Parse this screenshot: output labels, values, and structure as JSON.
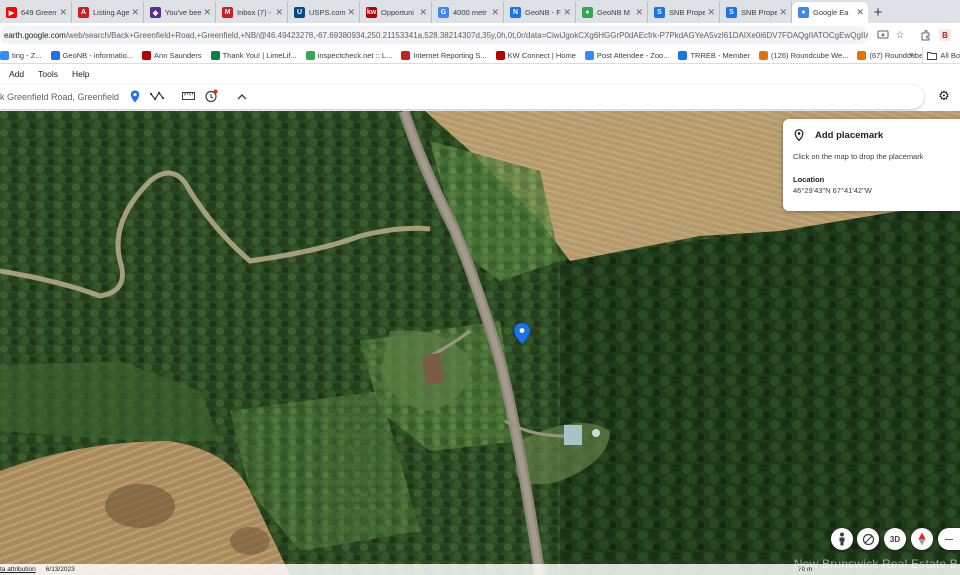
{
  "browser": {
    "tabs": [
      {
        "title": "649 Greenfi",
        "icon": "youtube-icon",
        "color": "#ff0000"
      },
      {
        "title": "Listing Age",
        "icon": "pdf-icon",
        "color": "#c5221f"
      },
      {
        "title": "You've bee",
        "icon": "shield-icon",
        "color": "#5c2d91"
      },
      {
        "title": "Inbox (7) -",
        "icon": "mail-icon",
        "color": "#c5221f"
      },
      {
        "title": "USPS.com",
        "icon": "usps-icon",
        "color": "#004b87"
      },
      {
        "title": "Opportuni",
        "icon": "kw-icon",
        "color": "#b40101"
      },
      {
        "title": "4000 metr",
        "icon": "google-icon",
        "color": "#4285f4"
      },
      {
        "title": "GeoNB - F",
        "icon": "geonb-icon",
        "color": "#1a73e8"
      },
      {
        "title": "GeoNB M",
        "icon": "globe-icon",
        "color": "#34a853"
      },
      {
        "title": "SNB Prope",
        "icon": "snb-icon",
        "color": "#1a73e8"
      },
      {
        "title": "SNB Prope",
        "icon": "snb-icon",
        "color": "#1a73e8"
      },
      {
        "title": "Google Ea",
        "icon": "google-earth-icon",
        "color": "#4285f4",
        "active": true
      }
    ],
    "new_tab_label": "+",
    "address": {
      "host": "earth.google.com",
      "path": "/web/search/Back+Greenfield+Road,+Greenfield,+NB/@46.49423278,-67.69380934,250.21153341a,528.38214307d,35y,0h,0t,0r/data=CiwiJgokCXg6HGGrP0dAEcfrk-P7PkdAGYeA5vzI61DAIXe0i6DV7FDAQgIIATOCgEwQgIIAEoNCP__"
    },
    "bookmarks": [
      {
        "label": "ting - Z...",
        "color": "#2d8cff"
      },
      {
        "label": "GeoNB - informatio...",
        "color": "#1a73e8"
      },
      {
        "label": "Ann Saunders",
        "color": "#b40101"
      },
      {
        "label": "Thank You! | LimeLif...",
        "color": "#0b8043"
      },
      {
        "label": "inspectcheck.net :: L...",
        "color": "#34a853"
      },
      {
        "label": "Internet Reporting S...",
        "color": "#c5221f"
      },
      {
        "label": "KW Connect | Home",
        "color": "#b40101"
      },
      {
        "label": "Post Attendee - Zoo...",
        "color": "#2d8cff"
      },
      {
        "label": "TRREB - Member",
        "color": "#1a73e8"
      },
      {
        "label": "(126) Roundcube We...",
        "color": "#e37400"
      },
      {
        "label": "(67) Roundcube We...",
        "color": "#e37400"
      }
    ],
    "bookmarks_more": "»",
    "all_bookmarks": "All Bo"
  },
  "earth": {
    "menu": [
      "Add",
      "Tools",
      "Help"
    ],
    "search_value": "k Greenfield Road, Greenfield",
    "placemark_panel": {
      "title": "Add placemark",
      "hint": "Click on the map to drop the placemark",
      "location_label": "Location",
      "location_value": "46°29'43\"N 67°41'42\"W"
    },
    "controls": {
      "pegman": "pegman-icon",
      "tilt": "tilt-icon",
      "view_3d": "3D",
      "compass": "compass-icon",
      "zoom_out": "—"
    },
    "status": {
      "attribution": "ta attribution",
      "date": "6/13/2023",
      "scale": "70 m"
    },
    "watermark": "New Brunswick Real Estate B"
  },
  "colors": {
    "accent": "#1a73e8",
    "marker": "#1a73e8",
    "forest": "#2c4a23",
    "field": "#b79a6a"
  }
}
